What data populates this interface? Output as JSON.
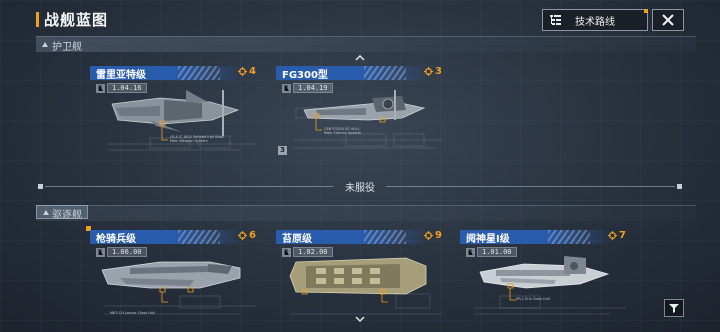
{
  "header": {
    "title": "战舰蓝图",
    "tech_button_label": "技术路线"
  },
  "sections": {
    "escort_label": "护卫舰",
    "destroyer_label": "驱逐舰",
    "not_in_service_label": "未服役"
  },
  "escort_cards": [
    {
      "name": "雷里亚特级",
      "count": "4",
      "meta": "1.04.16",
      "level": ""
    },
    {
      "name": "FG300型",
      "count": "3",
      "meta": "1.04.19",
      "level": "3"
    }
  ],
  "destroyer_cards": [
    {
      "name": "枪骑兵级",
      "count": "6",
      "meta": "1.06.00"
    },
    {
      "name": "苔原级",
      "count": "9",
      "meta": "1.02.00"
    },
    {
      "name": "阋神星I级",
      "count": "7",
      "meta": "1.01.00"
    }
  ],
  "colors": {
    "accent": "#f0a020",
    "card_header": "#2a5cae",
    "background": "#262f3b"
  },
  "icons": {
    "tech": "tech-tree-icon",
    "close": "close-icon",
    "count": "ship-count-icon",
    "filter": "filter-icon",
    "collapse": "chevron-up-icon",
    "expand": "chevron-down-icon"
  }
}
